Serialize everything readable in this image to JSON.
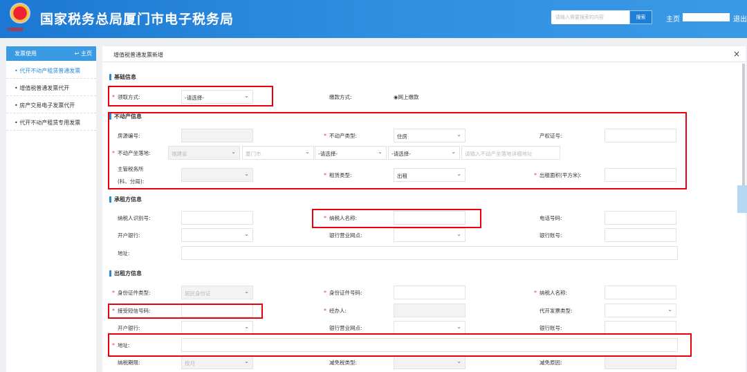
{
  "header": {
    "title": "国家税务总局厦门市电子税务局",
    "logo_text": "中国税务",
    "search_placeholder": "请输入需要搜索的内容",
    "search_btn": "搜索",
    "home": "主页",
    "logout": "退出"
  },
  "sidebar": {
    "title": "发票使用",
    "home": "主页",
    "items": [
      {
        "label": "代开不动产租赁普通发票"
      },
      {
        "label": "增值税普通发票代开"
      },
      {
        "label": "房产交易电子发票代开"
      },
      {
        "label": "代开不动产租赁专用发票"
      }
    ]
  },
  "panel": {
    "title": "增值税普通发票新增",
    "close": "×"
  },
  "basic": {
    "section": "基础信息",
    "pickup_label": "领取方式:",
    "pickup_value": "-请选择-",
    "pay_label": "缴款方式:",
    "pay_value": "网上缴款"
  },
  "property": {
    "section": "不动产信息",
    "source_no": "房源编号:",
    "type_label": "不动产类型:",
    "type_value": "住房",
    "cert_label": "产权证号:",
    "loc_label": "不动产坐落地:",
    "province": "福建省",
    "city": "厦门市",
    "district": "-请选择-",
    "street": "-请选择-",
    "addr_placeholder": "请输入不动产坐落地详细地址",
    "office_label1": "主管税务所",
    "office_label2": "(科、分局):",
    "lease_label": "租赁类型:",
    "lease_value": "出租",
    "area_label": "出租面积(平方米):"
  },
  "lessee": {
    "section": "承租方信息",
    "tin": "纳税人识别号:",
    "name": "纳税人名称:",
    "phone": "电话号码:",
    "bank": "开户银行:",
    "branch": "银行营业网点:",
    "account": "银行账号:",
    "address": "地址:"
  },
  "lessor": {
    "section": "出租方信息",
    "id_type": "身份证件类型:",
    "id_type_value": "居民身份证",
    "id_no": "身份证件号码:",
    "name": "纳税人名称:",
    "sms": "接受短信号码:",
    "agent": "经办人:",
    "invoice_type": "代开发票类型:",
    "bank": "开户银行:",
    "branch": "银行营业网点:",
    "account": "银行账号:",
    "address": "地址:",
    "period": "纳税期限:",
    "period_value": "按月",
    "relief_type": "减免税类型:",
    "relief_reason": "减免原因:"
  },
  "required_mark": "*",
  "chevron": "⌄"
}
